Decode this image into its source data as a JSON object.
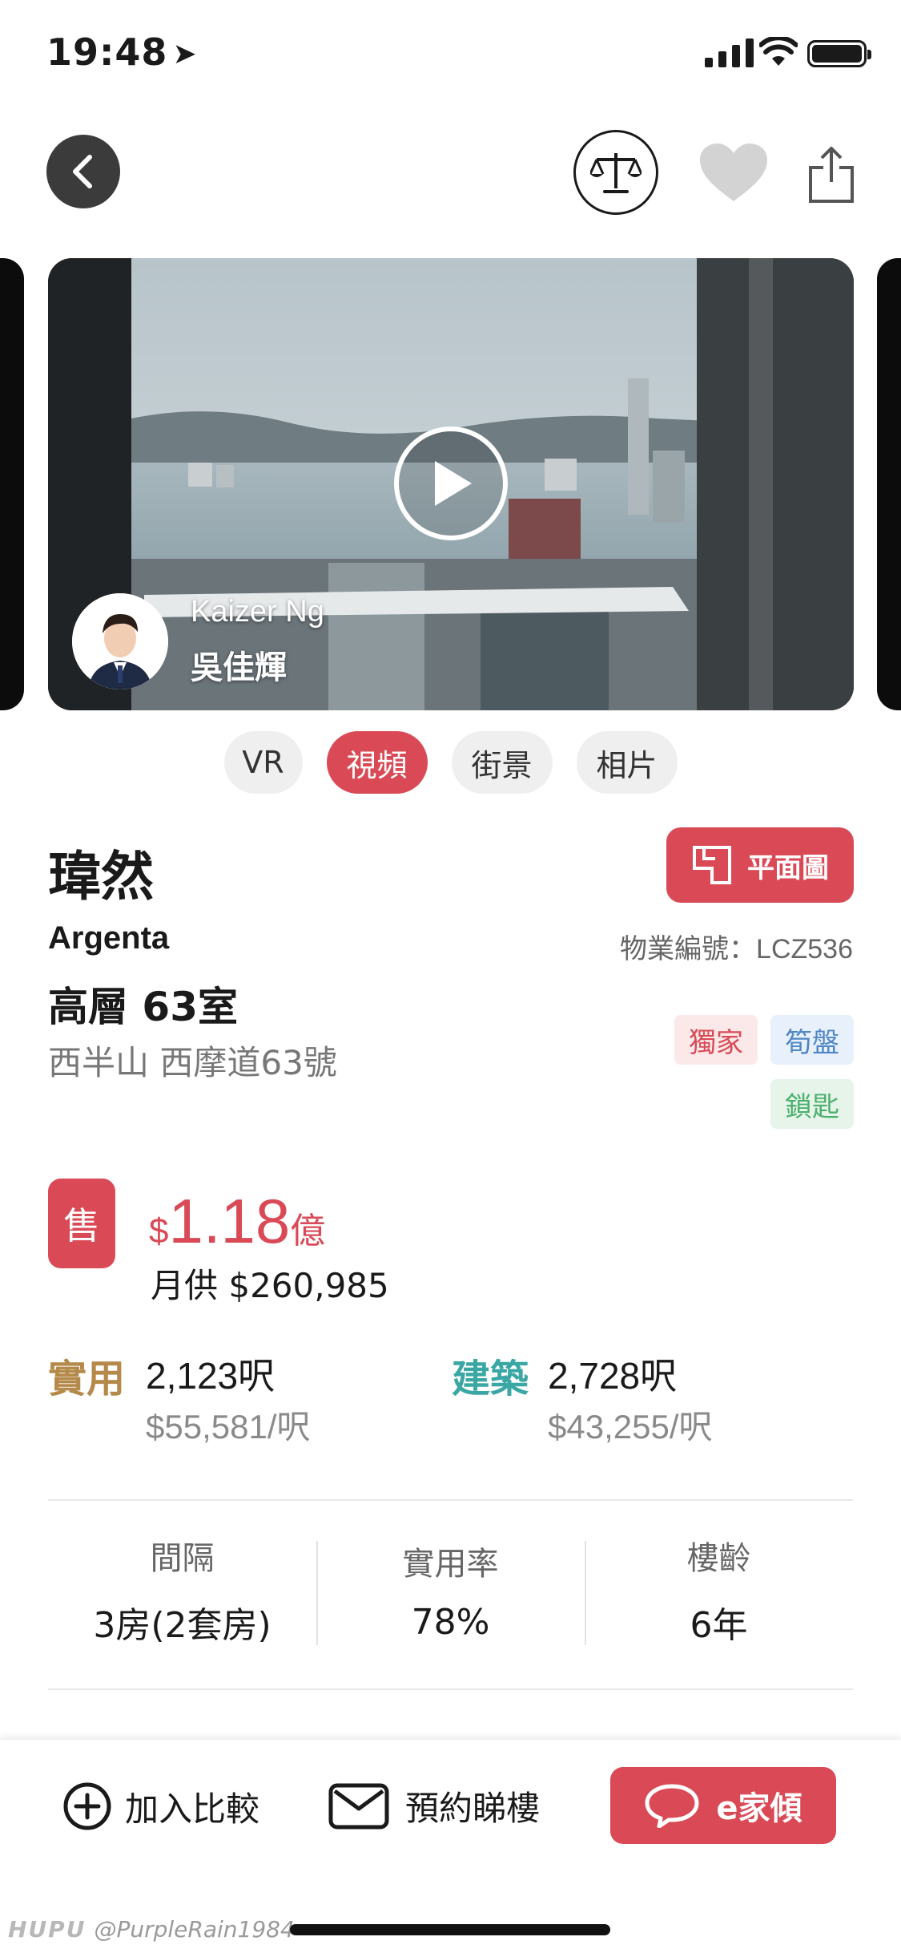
{
  "status_bar": {
    "time": "19:48",
    "location_icon": "location-arrow-icon",
    "signal_icon": "cellular-signal-icon",
    "wifi_icon": "wifi-icon",
    "battery_icon": "battery-full-icon"
  },
  "nav": {
    "back_icon": "chevron-left-icon",
    "compare_icon": "balance-scale-icon",
    "favorite_icon": "heart-icon",
    "share_icon": "share-icon"
  },
  "media": {
    "agent_name_en": "Kaizer Ng",
    "agent_name_zh": "吳佳輝",
    "tabs": [
      {
        "label": "VR",
        "active": false
      },
      {
        "label": "視頻",
        "active": true
      },
      {
        "label": "街景",
        "active": false
      },
      {
        "label": "相片",
        "active": false
      }
    ]
  },
  "listing": {
    "title_zh": "瑋然",
    "title_en": "Argenta",
    "floorplan_label": "平面圖",
    "property_code": "物業編號：LCZ536",
    "unit": "高層 63室",
    "address": "西半山 西摩道63號",
    "tags": {
      "exclusive": "獨家",
      "new": "筍盤",
      "key": "鎖匙"
    }
  },
  "price": {
    "badge": "售",
    "currency": "$",
    "amount": "1.18",
    "unit": "億",
    "monthly": "月供 $260,985"
  },
  "area": {
    "net_label": "實用",
    "net_size": "2,123呎",
    "net_ppf": "$55,581/呎",
    "gross_label": "建築",
    "gross_size": "2,728呎",
    "gross_ppf": "$43,255/呎"
  },
  "stats": [
    {
      "label": "間隔",
      "value": "3房(2套房)"
    },
    {
      "label": "實用率",
      "value": "78%"
    },
    {
      "label": "樓齡",
      "value": "6年"
    }
  ],
  "bottom_bar": {
    "compare_label": "加入比較",
    "visit_label": "預約睇樓",
    "chat_label": "e家傾"
  },
  "watermark": {
    "brand": "HUPU",
    "user": "@PurpleRain1984"
  },
  "colors": {
    "accent": "#d94a56",
    "net_area": "#b5894a",
    "gross_area": "#3aa7a5"
  }
}
